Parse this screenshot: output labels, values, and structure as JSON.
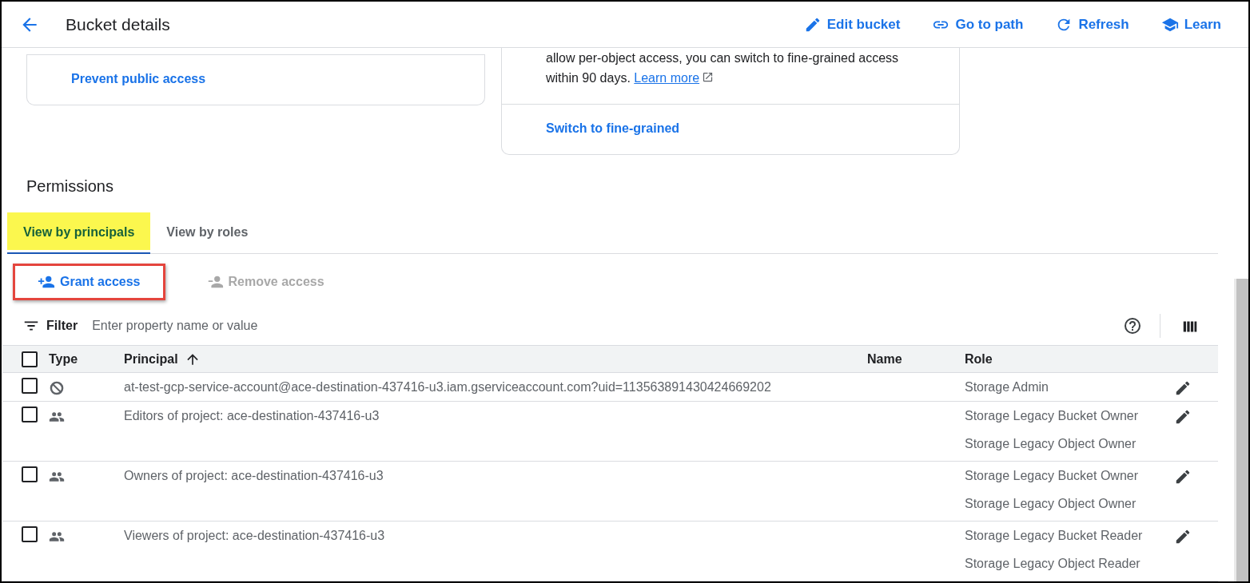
{
  "header": {
    "title": "Bucket details",
    "actions": [
      {
        "kind": "edit",
        "label": "Edit bucket"
      },
      {
        "kind": "link",
        "label": "Go to path"
      },
      {
        "kind": "refresh",
        "label": "Refresh"
      },
      {
        "kind": "learn",
        "label": "Learn"
      }
    ]
  },
  "cards": [
    {
      "link": "Prevent public access"
    },
    {
      "text": "allow per-object access, you can switch to fine-grained access within 90 days.",
      "text_link": "Learn more",
      "link": "Switch to fine-grained"
    }
  ],
  "permissions": {
    "title": "Permissions",
    "tabs": [
      {
        "label": "View by principals",
        "selected": true,
        "highlighted": true
      },
      {
        "label": "View by roles",
        "selected": false,
        "highlighted": false
      }
    ],
    "toolbar": [
      {
        "kind": "add",
        "label": "Grant access",
        "disabled": false,
        "outlined": true
      },
      {
        "kind": "remove",
        "label": "Remove access",
        "disabled": true,
        "outlined": false
      }
    ],
    "filter": {
      "label": "Filter",
      "placeholder": "Enter property name or value"
    },
    "table": {
      "columns": [
        {
          "label": "Type",
          "sorted": false
        },
        {
          "label": "Principal",
          "sorted": true
        },
        {
          "label": "Name",
          "sorted": false
        },
        {
          "label": "Role",
          "sorted": false
        }
      ],
      "all_checked": false,
      "rows": [
        {
          "kind": "service_account",
          "checked": false,
          "principal": "at-test-gcp-service-account@ace-destination-437416-u3.iam.gserviceaccount.com?uid=113563891430424669202",
          "roles": [
            "Storage Admin"
          ]
        },
        {
          "kind": "group",
          "checked": false,
          "principal": "Editors of project: ace-destination-437416-u3",
          "roles": [
            "Storage Legacy Bucket Owner",
            "Storage Legacy Object Owner"
          ]
        },
        {
          "kind": "group",
          "checked": false,
          "principal": "Owners of project: ace-destination-437416-u3",
          "roles": [
            "Storage Legacy Bucket Owner",
            "Storage Legacy Object Owner"
          ]
        },
        {
          "kind": "group",
          "checked": false,
          "principal": "Viewers of project: ace-destination-437416-u3",
          "roles": [
            "Storage Legacy Bucket Reader",
            "Storage Legacy Object Reader"
          ]
        }
      ]
    }
  }
}
